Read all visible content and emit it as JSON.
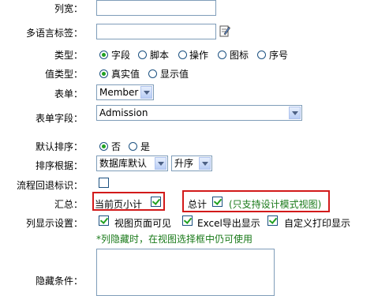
{
  "rows": {
    "col_width": {
      "label": "列宽：",
      "value": ""
    },
    "multi_lang": {
      "label": "多语言标签：",
      "value": ""
    },
    "type": {
      "label": "类型：",
      "options": [
        "字段",
        "脚本",
        "操作",
        "图标",
        "序号"
      ],
      "selected": "字段"
    },
    "value_type": {
      "label": "值类型：",
      "options": [
        "真实值",
        "显示值"
      ],
      "selected": "真实值"
    },
    "form": {
      "label": "表单：",
      "selected": "Member"
    },
    "form_field": {
      "label": "表单字段：",
      "selected": "Admission"
    },
    "default_sort": {
      "label": "默认排序：",
      "options": [
        "否",
        "是"
      ],
      "selected": "否"
    },
    "sort_by": {
      "label": "排序根据：",
      "selected": "数据库默认",
      "order": "升序"
    },
    "flow_back": {
      "label": "流程回退标识：",
      "checked": false
    },
    "summary": {
      "label": "汇总：",
      "page_subtotal": {
        "label": "当前页小计",
        "checked": true
      },
      "total": {
        "label": "总计",
        "checked": true,
        "note": "(只支持设计模式视图)"
      }
    },
    "column_display": {
      "label": "列显示设置：",
      "options": [
        {
          "label": "视图页面可见",
          "checked": true
        },
        {
          "label": "Excel导出显示",
          "checked": true
        },
        {
          "label": "自定义打印显示",
          "checked": true
        }
      ],
      "hint": "*列隐藏时，在视图选择框中仍可使用"
    },
    "hide_condition": {
      "label": "隐藏条件：",
      "value": ""
    }
  },
  "colors": {
    "accent_green": "#21a121",
    "highlight_red": "#d21a1a",
    "hint_green": "#1a7a1a"
  },
  "icons": {
    "edit": "edit-note-icon"
  }
}
